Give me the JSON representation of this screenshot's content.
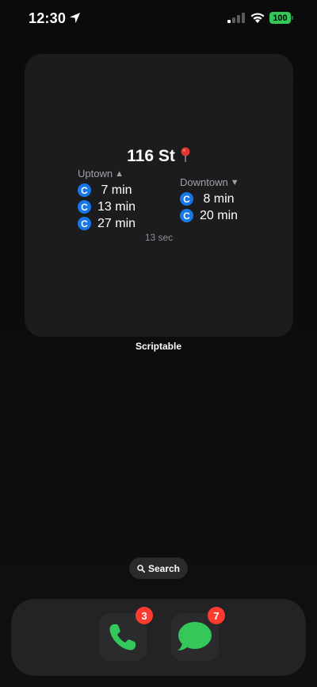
{
  "status_bar": {
    "time": "12:30",
    "battery": "100",
    "location_icon": "location-arrow-icon",
    "signal_icon": "cellular-signal-icon",
    "wifi_icon": "wifi-icon"
  },
  "widget": {
    "station": "116 St",
    "station_icon": "round-pushpin-icon",
    "uptown": {
      "label": "Uptown",
      "arrow": "▲",
      "arrivals": [
        {
          "line": "C",
          "text": " 7 min"
        },
        {
          "line": "C",
          "text": "13 min"
        },
        {
          "line": "C",
          "text": "27 min"
        }
      ]
    },
    "downtown": {
      "label": "Downtown",
      "arrow": "▼",
      "arrivals": [
        {
          "line": "C",
          "text": " 8 min"
        },
        {
          "line": "C",
          "text": "20 min"
        }
      ]
    },
    "updated": "13 sec",
    "name": "Scriptable",
    "line_color": "#1877e6"
  },
  "search": {
    "label": "Search"
  },
  "dock": {
    "apps": [
      {
        "name": "Phone",
        "badge": "3",
        "icon": "phone-icon"
      },
      {
        "name": "Messages",
        "badge": "7",
        "icon": "messages-icon"
      }
    ]
  }
}
